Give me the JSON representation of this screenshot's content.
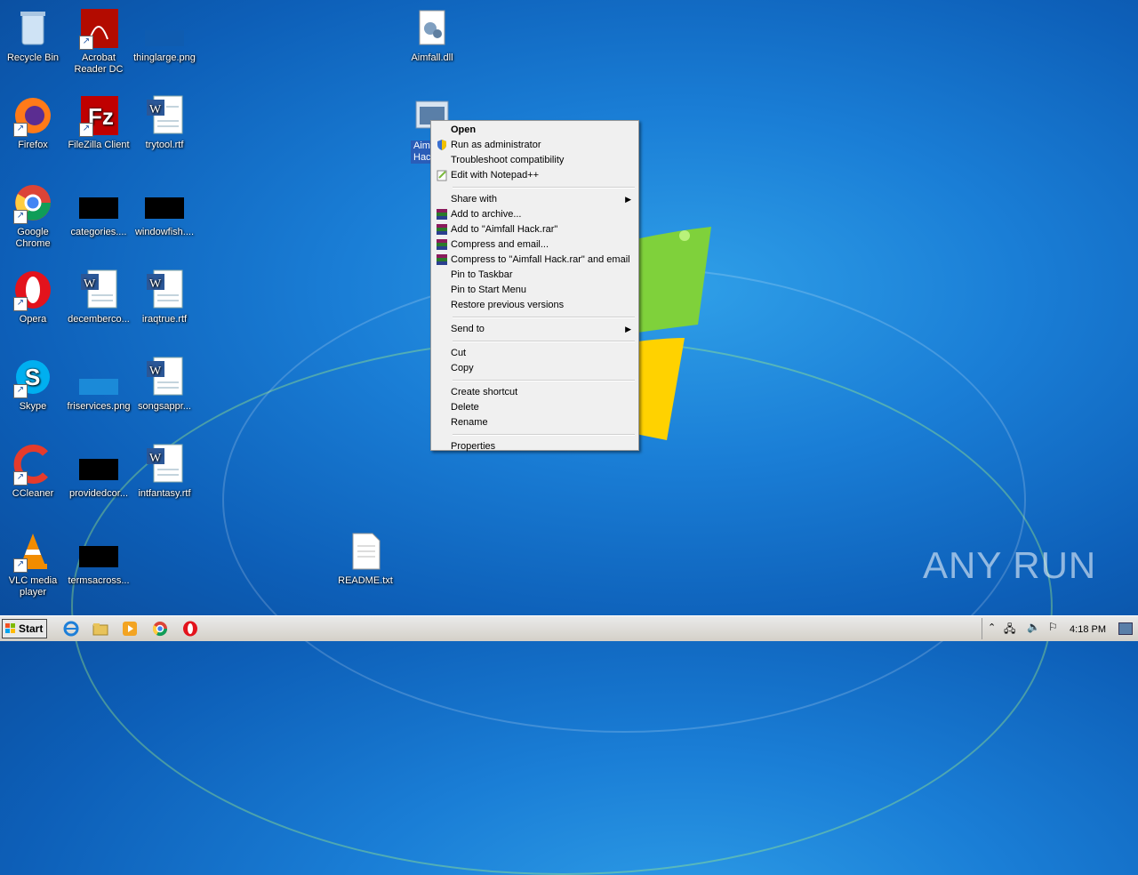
{
  "desktop": {
    "icons": [
      {
        "label": "Recycle Bin"
      },
      {
        "label": "Acrobat Reader DC"
      },
      {
        "label": "thinglarge.png"
      },
      {
        "label": "Aimfall.dll"
      },
      {
        "label": "Firefox"
      },
      {
        "label": "FileZilla Client"
      },
      {
        "label": "trytool.rtf"
      },
      {
        "label": "Aimfall Hack"
      },
      {
        "label": "Google Chrome"
      },
      {
        "label": "categories...."
      },
      {
        "label": "windowfish...."
      },
      {
        "label": "Opera"
      },
      {
        "label": "decemberco..."
      },
      {
        "label": "iraqtrue.rtf"
      },
      {
        "label": "Skype"
      },
      {
        "label": "friservices.png"
      },
      {
        "label": "songsappr..."
      },
      {
        "label": "CCleaner"
      },
      {
        "label": "providedcor..."
      },
      {
        "label": "intfantasy.rtf"
      },
      {
        "label": "VLC media player"
      },
      {
        "label": "termsacross..."
      },
      {
        "label": "README.txt"
      }
    ],
    "selected_partial_label": "Aim\nHack"
  },
  "context_menu": {
    "items": [
      {
        "label": "Open",
        "bold": true
      },
      {
        "label": "Run as administrator",
        "icon": "shield-icon"
      },
      {
        "label": "Troubleshoot compatibility"
      },
      {
        "label": "Edit with Notepad++",
        "icon": "notepadpp-icon"
      },
      {
        "label": "Share with",
        "submenu": true
      },
      {
        "label": "Add to archive...",
        "icon": "winrar-icon"
      },
      {
        "label": "Add to \"Aimfall Hack.rar\"",
        "icon": "winrar-icon"
      },
      {
        "label": "Compress and email...",
        "icon": "winrar-icon"
      },
      {
        "label": "Compress to \"Aimfall Hack.rar\" and email",
        "icon": "winrar-icon"
      },
      {
        "label": "Pin to Taskbar"
      },
      {
        "label": "Pin to Start Menu"
      },
      {
        "label": "Restore previous versions"
      },
      {
        "label": "Send to",
        "submenu": true
      },
      {
        "label": "Cut"
      },
      {
        "label": "Copy"
      },
      {
        "label": "Create shortcut"
      },
      {
        "label": "Delete"
      },
      {
        "label": "Rename"
      },
      {
        "label": "Properties"
      }
    ]
  },
  "taskbar": {
    "start_label": "Start",
    "clock": "4:18 PM",
    "pinned": [
      "internet-explorer-icon",
      "explorer-icon",
      "media-player-icon",
      "chrome-icon",
      "opera-icon"
    ]
  },
  "watermark": "ANY RUN",
  "colors": {
    "desktop_bg": "#1a7ed6",
    "menu_bg": "#f0f0f0",
    "selection": "#2a5db8"
  }
}
